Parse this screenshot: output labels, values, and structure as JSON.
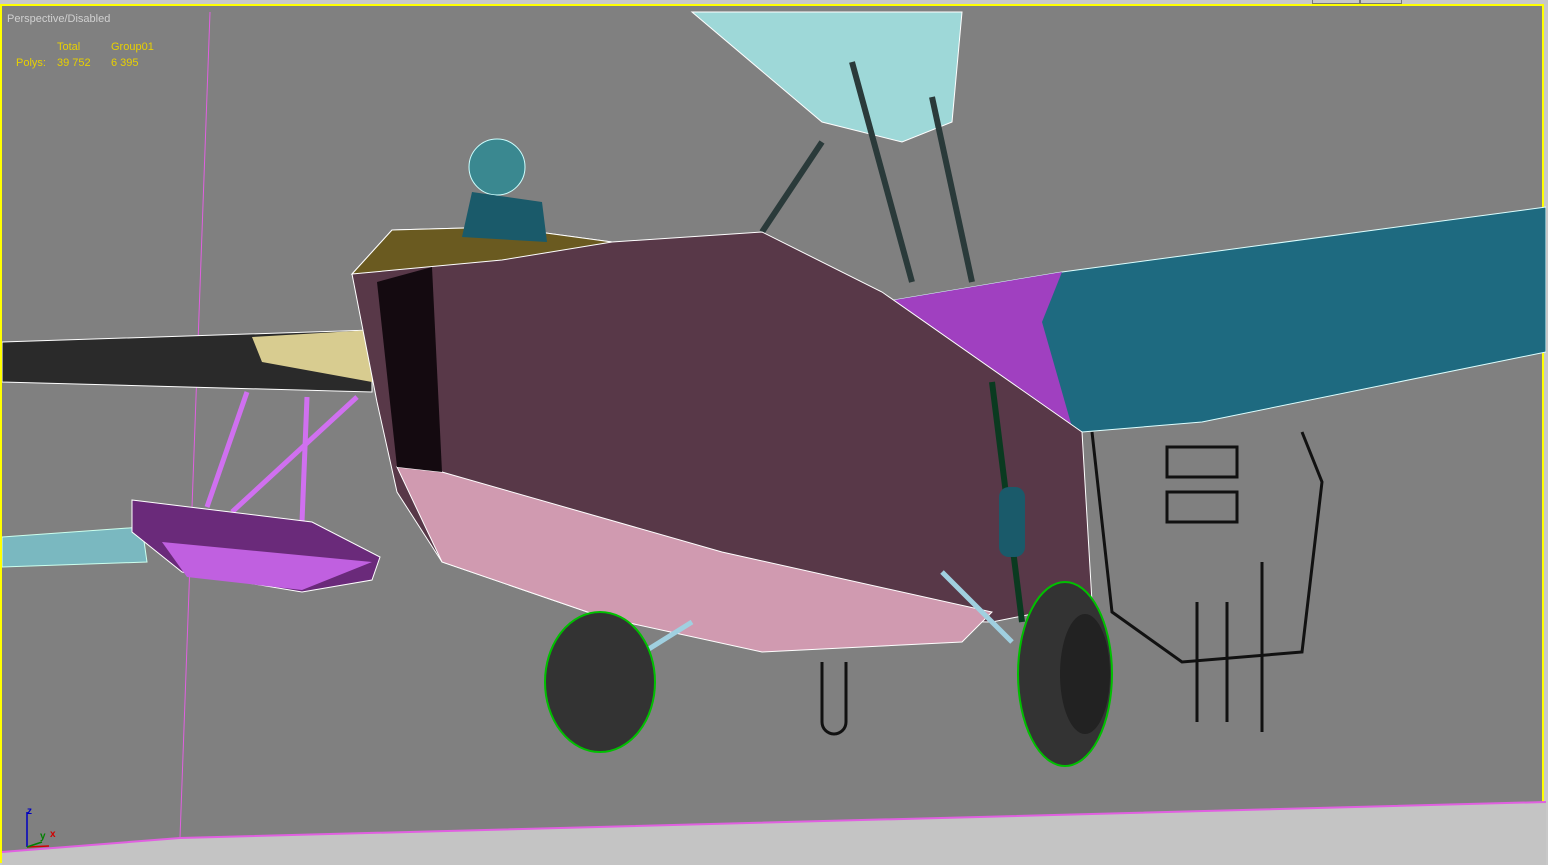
{
  "viewport": {
    "label": "Perspective/Disabled"
  },
  "stats": {
    "col_total": "Total",
    "col_group": "Group01",
    "row_label": "Polys:",
    "total": "39 752",
    "group": "6 395"
  },
  "gizmo": {
    "z": "z",
    "y": "y",
    "x": "x"
  },
  "colors": {
    "border": "#ffff00",
    "background": "#808080",
    "stats": "#e8d000"
  }
}
